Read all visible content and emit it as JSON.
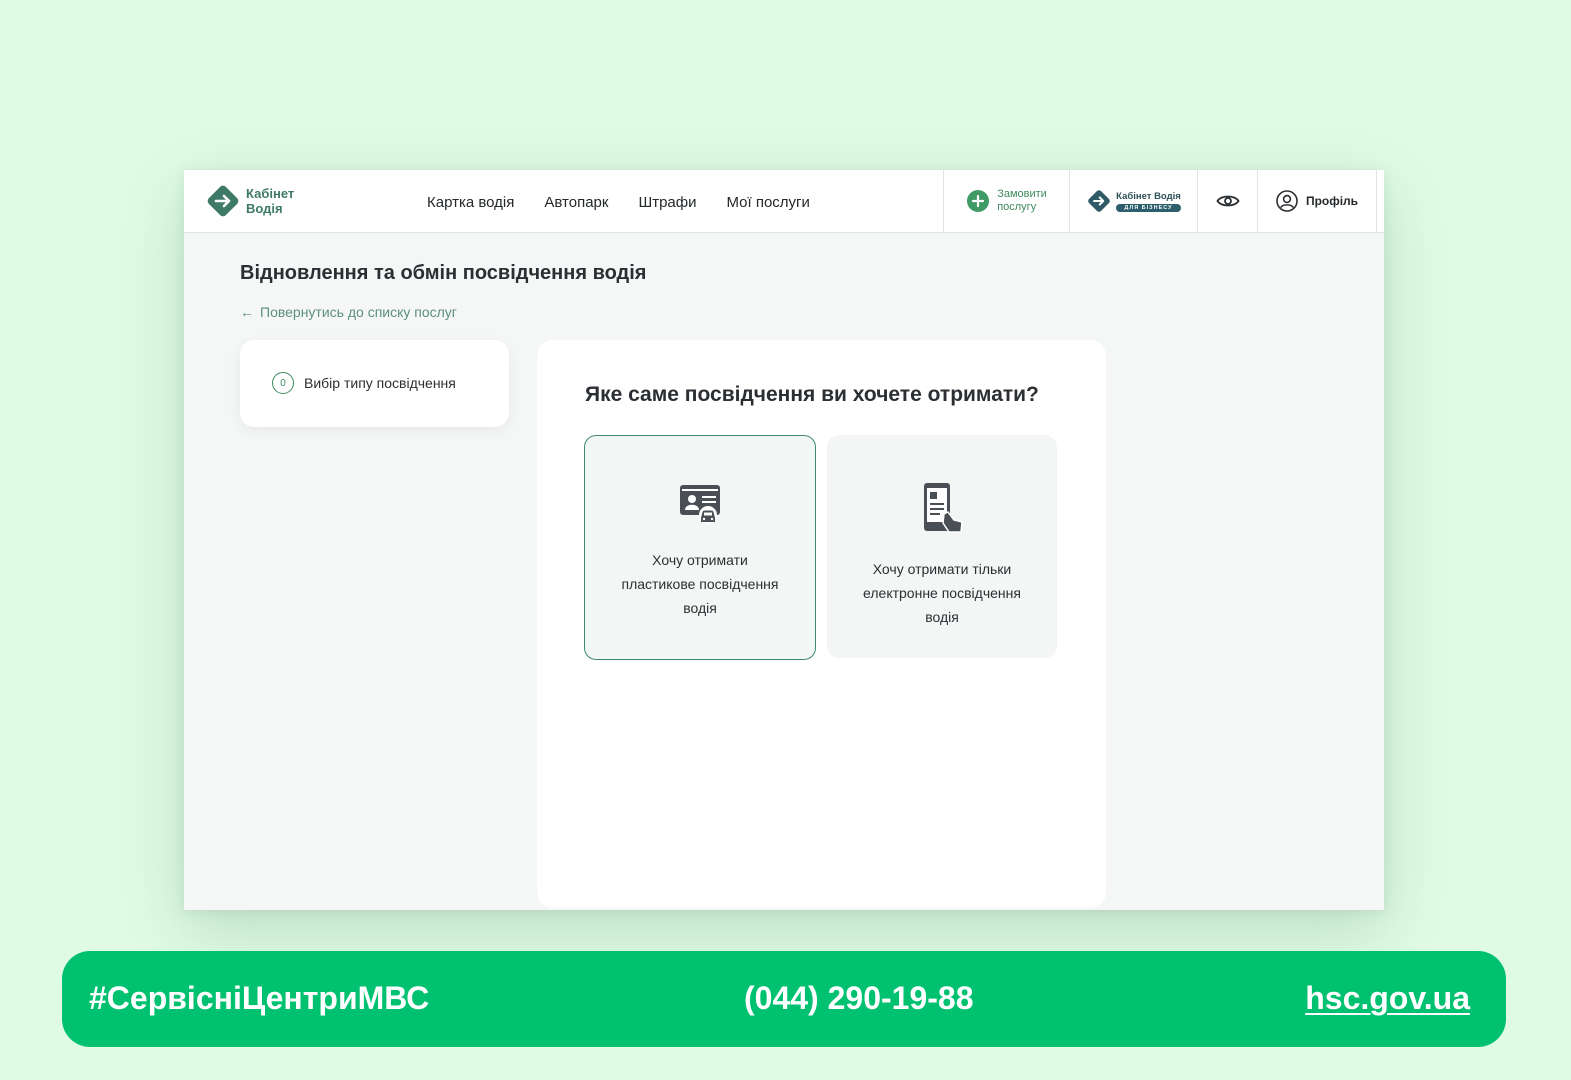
{
  "app": {
    "logo_line1": "Кабінет",
    "logo_line2": "Водія"
  },
  "nav": {
    "items": [
      "Картка водія",
      "Автопарк",
      "Штрафи",
      "Мої послуги"
    ]
  },
  "header": {
    "order_line1": "Замовити",
    "order_line2": "послугу",
    "business_title": "Кабінет Водія",
    "business_badge": "ДЛЯ БІЗНЕСУ",
    "profile_label": "Профіль"
  },
  "page": {
    "title": "Відновлення та обмін посвідчення водія",
    "back_link": "Повернутись до списку послуг"
  },
  "steps": [
    {
      "number": "0",
      "label": "Вибір типу посвідчення"
    }
  ],
  "main": {
    "question": "Яке саме посвідчення ви хочете отримати?",
    "options": [
      {
        "icon": "driver-license-card-icon",
        "line1": "Хочу отримати",
        "line2": "пластикове посвідчення",
        "line3": "водія",
        "selected": true
      },
      {
        "icon": "smartphone-document-icon",
        "line1": "Хочу отримати тільки",
        "line2": "електронне посвідчення",
        "line3": "водія",
        "selected": false
      }
    ]
  },
  "banner": {
    "hashtag": "#СервісніЦентриМВС",
    "phone": "(044) 290-19-88",
    "site": "hsc.gov.ua"
  },
  "colors": {
    "background": "#dffbe4",
    "accent_green": "#3f8a5e",
    "banner_green": "#00c170",
    "logo_teal": "#3f7a68"
  }
}
